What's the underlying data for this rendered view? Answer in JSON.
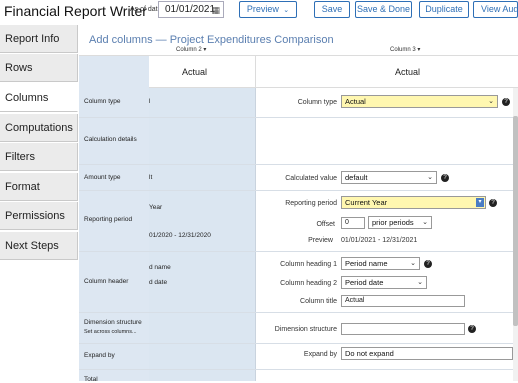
{
  "header": {
    "title": "Financial Report Writer",
    "as_of_label": "As of date",
    "as_of_value": "01/01/2021",
    "buttons": {
      "preview": "Preview",
      "save": "Save",
      "save_done": "Save & Done",
      "duplicate": "Duplicate",
      "audit": "View Audit"
    }
  },
  "sidebar": {
    "items": [
      {
        "label": "Report Info"
      },
      {
        "label": "Rows"
      },
      {
        "label": "Columns"
      },
      {
        "label": "Computations"
      },
      {
        "label": "Filters"
      },
      {
        "label": "Format"
      },
      {
        "label": "Permissions"
      },
      {
        "label": "Next Steps"
      }
    ]
  },
  "main": {
    "heading": "Add columns — Project Expenditures Comparison",
    "column2_label": "Column 2 ▾",
    "column3_label": "Column 3 ▾",
    "column2_title": "Actual",
    "column3_title": "Actual",
    "row_labels": {
      "column_type": "Column type",
      "calculation_details": "Calculation details",
      "amount_type": "Amount type",
      "reporting_period": "Reporting period",
      "column_header": "Column header",
      "dimension_structure": "Dimension structure",
      "set_across": "Set across columns...",
      "expand_by": "Expand by",
      "total": "Total"
    },
    "col2_values": {
      "column_type": "l",
      "amount_type": "lt",
      "reporting_period_1": "Year",
      "reporting_period_2": "01/2020 - 12/31/2020",
      "heading1": "d name",
      "heading2": "d date"
    },
    "col3": {
      "column_type_label": "Column type",
      "column_type_value": "Actual",
      "calculated_value_label": "Calculated value",
      "calculated_value": "default",
      "reporting_period_label": "Reporting period",
      "reporting_period_value": "Current Year",
      "offset_label": "Offset",
      "offset_value": "0",
      "offset_unit": "prior periods",
      "preview_label": "Preview",
      "preview_value": "01/01/2021 - 12/31/2021",
      "heading1_label": "Column heading 1",
      "heading1_value": "Period name",
      "heading2_label": "Column heading 2",
      "heading2_value": "Period date",
      "title_label": "Column title",
      "title_value": "Actual",
      "dimension_label": "Dimension structure",
      "dimension_value": "",
      "expand_label": "Expand by",
      "expand_value": "Do not expand"
    }
  }
}
